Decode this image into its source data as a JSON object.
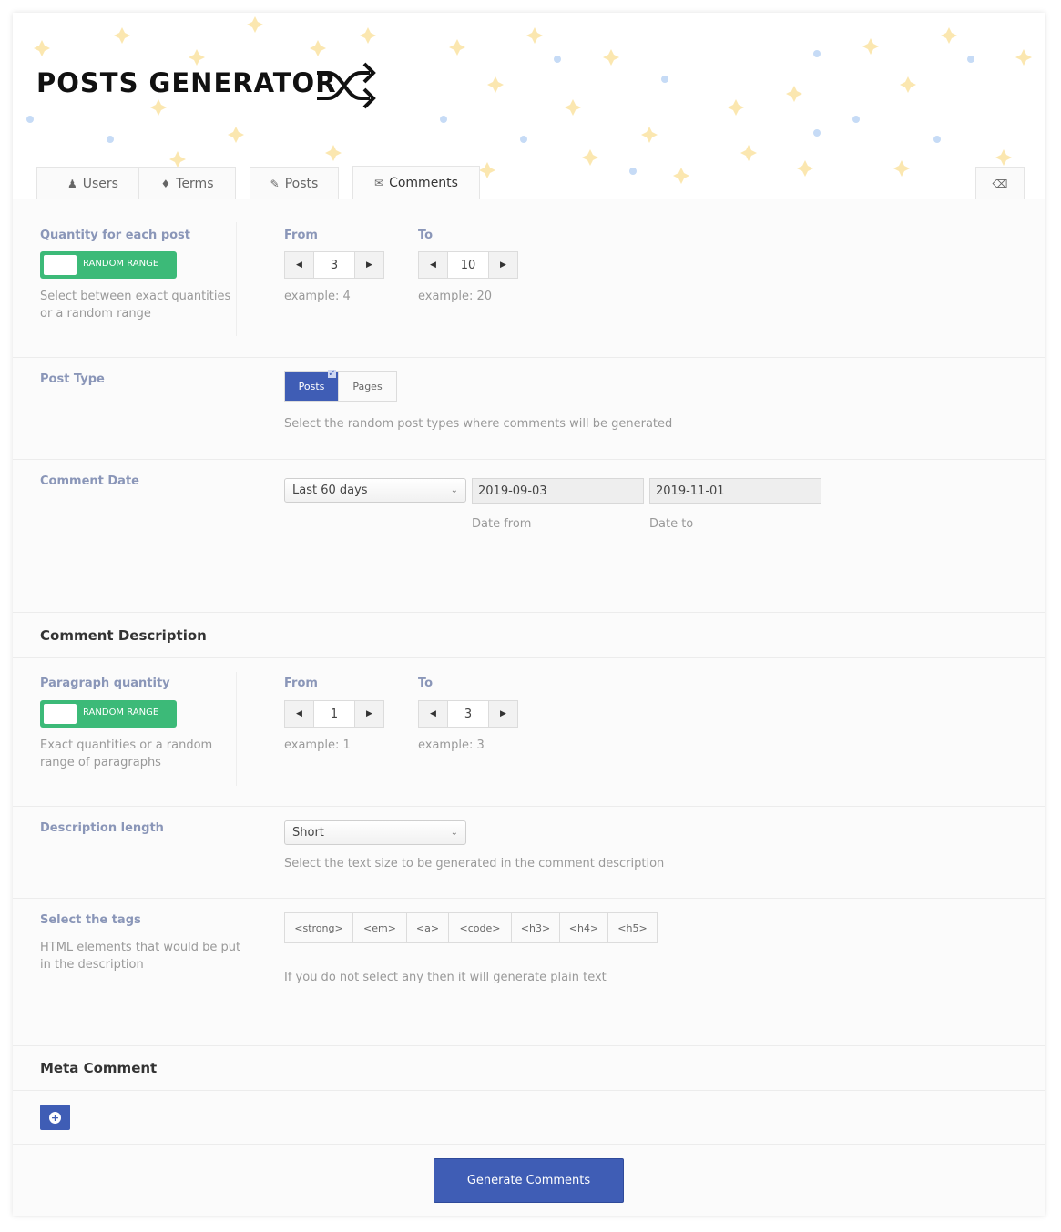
{
  "app": {
    "title": "POSTS GENERATOR"
  },
  "tabs": [
    {
      "label": "Users",
      "icon": "user-icon"
    },
    {
      "label": "Terms",
      "icon": "tags-icon"
    },
    {
      "label": "Posts",
      "icon": "edit-icon"
    },
    {
      "label": "Comments",
      "icon": "comments-icon",
      "active": true
    }
  ],
  "quantity": {
    "label": "Quantity for each post",
    "toggle_label": "RANDOM RANGE",
    "help": "Select between exact quantities or a random range",
    "from_label": "From",
    "from_value": "3",
    "from_example": "example: 4",
    "to_label": "To",
    "to_value": "10",
    "to_example": "example: 20"
  },
  "post_type": {
    "label": "Post Type",
    "options": [
      "Posts",
      "Pages"
    ],
    "selected": "Posts",
    "help": "Select the random post types where comments will be generated"
  },
  "comment_date": {
    "label": "Comment Date",
    "range_value": "Last 60 days",
    "date_from": "2019-09-03",
    "date_to": "2019-11-01",
    "date_from_label": "Date from",
    "date_to_label": "Date to"
  },
  "comment_description": {
    "heading": "Comment Description",
    "paragraph": {
      "label": "Paragraph quantity",
      "toggle_label": "RANDOM RANGE",
      "help": "Exact quantities or a random range of paragraphs",
      "from_label": "From",
      "from_value": "1",
      "from_example": "example: 1",
      "to_label": "To",
      "to_value": "3",
      "to_example": "example: 3"
    },
    "length": {
      "label": "Description length",
      "value": "Short",
      "help": "Select the text size to be generated in the comment description"
    },
    "tags": {
      "label": "Select the tags",
      "help_left": "HTML elements that would be put in the description",
      "options": [
        "<strong>",
        "<em>",
        "<a>",
        "<code>",
        "<h3>",
        "<h4>",
        "<h5>"
      ],
      "help": "If you do not select any then it will generate plain text"
    }
  },
  "meta_comment": {
    "heading": "Meta Comment"
  },
  "actions": {
    "generate_label": "Generate Comments"
  },
  "colors": {
    "accent": "#3f5db5",
    "toggle_on": "#3cba78",
    "label": "#8a96b8"
  }
}
